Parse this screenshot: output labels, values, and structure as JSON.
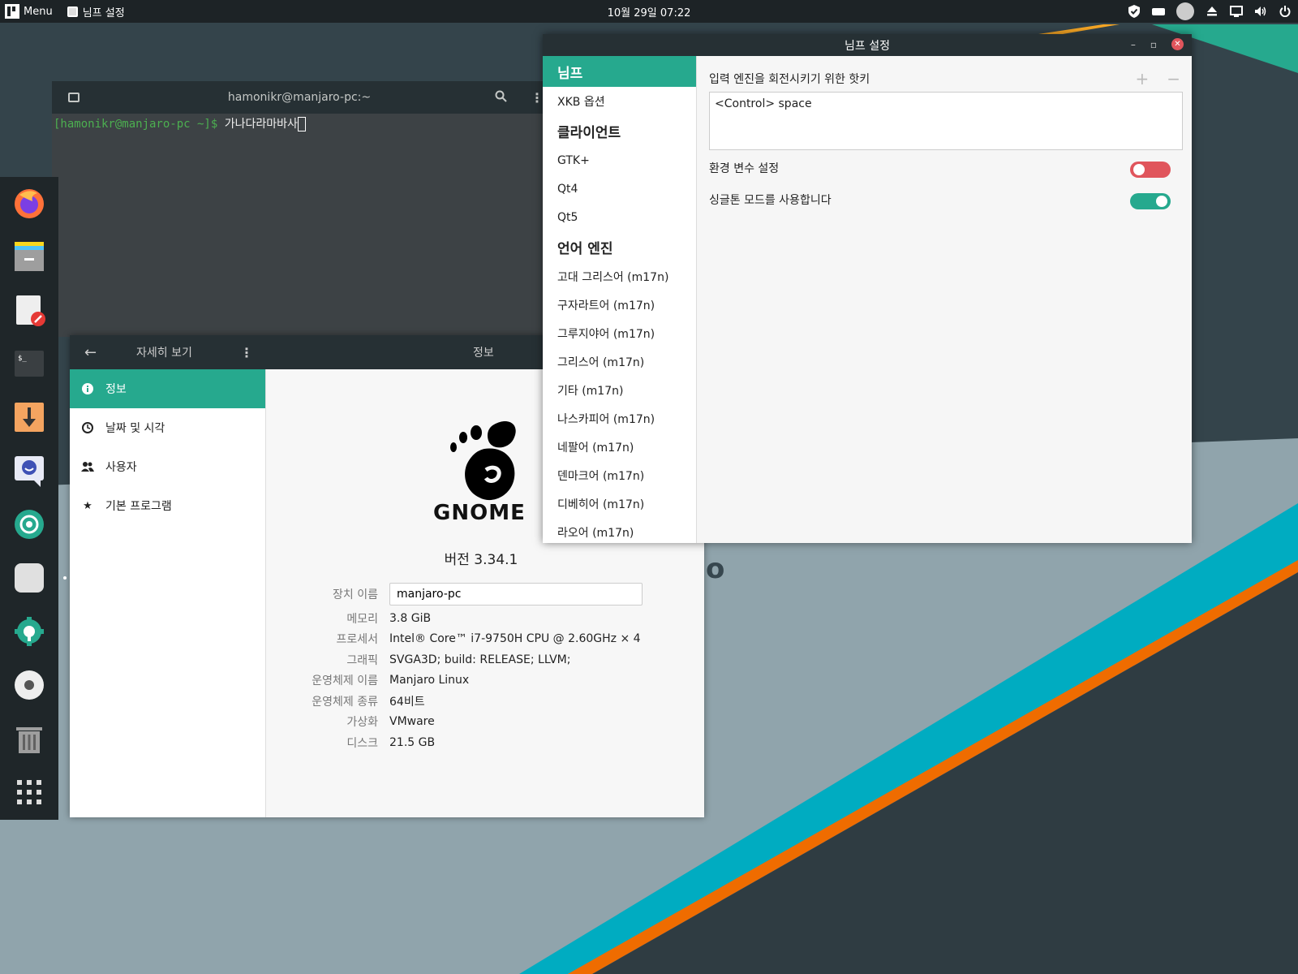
{
  "topbar": {
    "menu_label": "Menu",
    "active_app": "님프 설정",
    "clock": "10월 29일  07:22"
  },
  "terminal": {
    "title": "hamonikr@manjaro-pc:~",
    "prompt": "[hamonikr@manjaro-pc ~]$",
    "input_text": "가나다라마바사"
  },
  "about": {
    "header_section": "자세히 보기",
    "header_page": "정보",
    "sidebar": [
      {
        "label": "정보",
        "icon": "info-icon"
      },
      {
        "label": "날짜 및 시각",
        "icon": "clock-icon"
      },
      {
        "label": "사용자",
        "icon": "users-icon"
      },
      {
        "label": "기본 프로그램",
        "icon": "star-icon"
      }
    ],
    "logo_text": "GNOME",
    "version": "버전 3.34.1",
    "info": {
      "device_name_label": "장치 이름",
      "device_name_value": "manjaro-pc",
      "rows": [
        {
          "key": "메모리",
          "value": "3.8 GiB"
        },
        {
          "key": "프로세서",
          "value": "Intel® Core™ i7-9750H CPU @ 2.60GHz × 4"
        },
        {
          "key": "그래픽",
          "value": "SVGA3D; build: RELEASE; LLVM;"
        },
        {
          "key": "운영체제 이름",
          "value": "Manjaro Linux"
        },
        {
          "key": "운영체제 종류",
          "value": "64비트"
        },
        {
          "key": "가상화",
          "value": "VMware"
        },
        {
          "key": "디스크",
          "value": "21.5 GB"
        }
      ]
    }
  },
  "nimf": {
    "title": "님프 설정",
    "nav": [
      {
        "label": "님프",
        "type": "header",
        "active": true
      },
      {
        "label": "XKB 옵션",
        "type": "item"
      },
      {
        "label": "클라이언트",
        "type": "header"
      },
      {
        "label": "GTK+",
        "type": "item"
      },
      {
        "label": "Qt4",
        "type": "item"
      },
      {
        "label": "Qt5",
        "type": "item"
      },
      {
        "label": "언어 엔진",
        "type": "header"
      },
      {
        "label": "고대 그리스어 (m17n)",
        "type": "item"
      },
      {
        "label": "구자라트어 (m17n)",
        "type": "item"
      },
      {
        "label": "그루지야어 (m17n)",
        "type": "item"
      },
      {
        "label": "그리스어 (m17n)",
        "type": "item"
      },
      {
        "label": "기타 (m17n)",
        "type": "item"
      },
      {
        "label": "나스카피어 (m17n)",
        "type": "item"
      },
      {
        "label": "네팔어 (m17n)",
        "type": "item"
      },
      {
        "label": "덴마크어 (m17n)",
        "type": "item"
      },
      {
        "label": "디베히어 (m17n)",
        "type": "item"
      },
      {
        "label": "라오어 (m17n)",
        "type": "item"
      }
    ],
    "hotkey_label": "입력 엔진을 회전시키기 위한 핫키",
    "hotkey_value": "<Control> space",
    "env_label": "환경 변수 설정",
    "env_enabled": false,
    "singleton_label": "싱글톤 모드를 사용합니다",
    "singleton_enabled": true
  },
  "colors": {
    "accent": "#26a98e",
    "toggle_off": "#e0555c",
    "headerbar": "#263034"
  }
}
